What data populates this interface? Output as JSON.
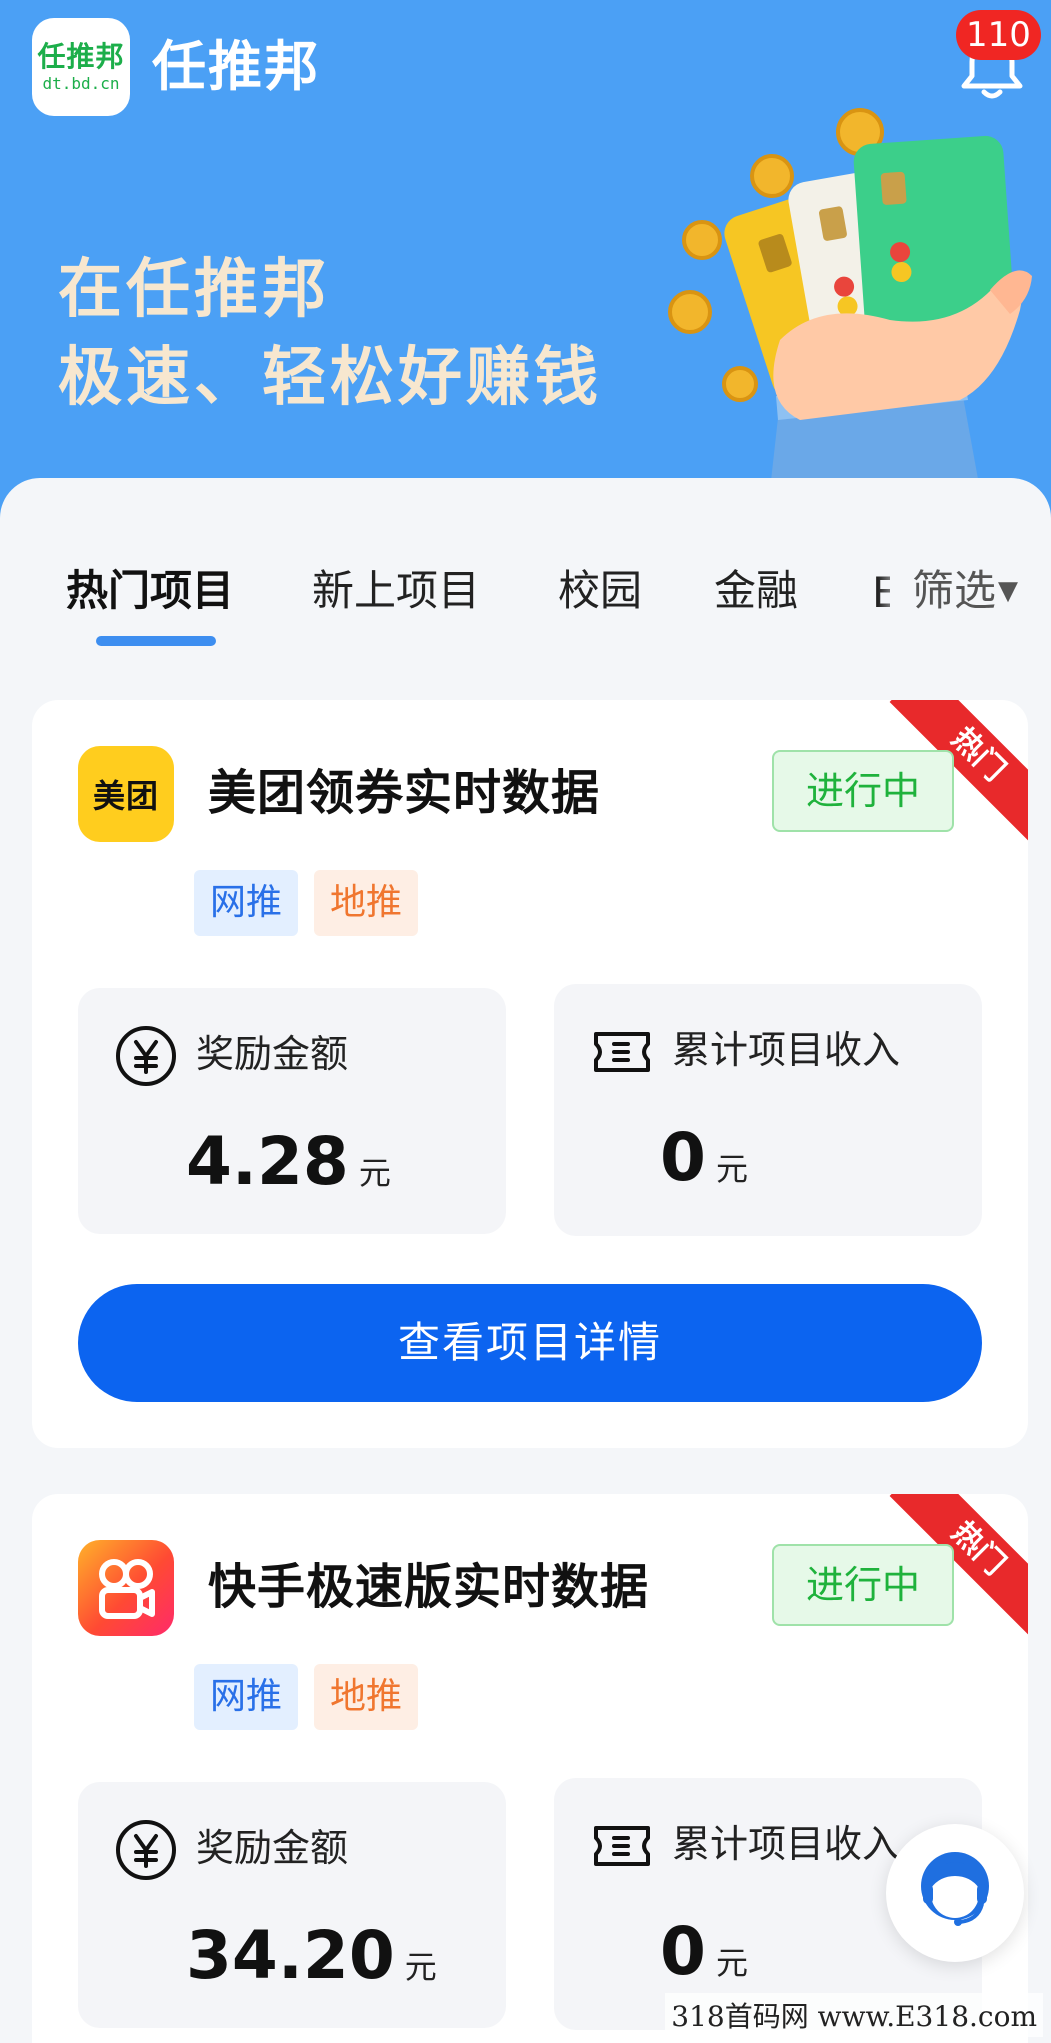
{
  "header": {
    "logo_text": "任推邦",
    "logo_domain": "dt.bd.cn",
    "app_title": "任推邦",
    "notification_count": "110",
    "slogan_line1": "在任推邦",
    "slogan_line2": "极速、轻松好赚钱",
    "banner_color": "#4ba0f5"
  },
  "tabs": {
    "items": [
      {
        "label": "热门项目",
        "active": true
      },
      {
        "label": "新上项目",
        "active": false
      },
      {
        "label": "校园",
        "active": false
      },
      {
        "label": "金融",
        "active": false
      }
    ],
    "overflow_partial": "E",
    "filter_label": "筛选",
    "filter_icon": "caret-down-icon"
  },
  "projects": [
    {
      "icon_text": "美团",
      "name": "美团领券实时数据",
      "status": "进行中",
      "hot_label": "热门",
      "tags": [
        "网推",
        "地推"
      ],
      "reward_label": "奖励金额",
      "reward_value": "4.28",
      "reward_unit": "元",
      "income_label": "累计项目收入",
      "income_value": "0",
      "income_unit": "元",
      "button_label": "查看项目详情"
    },
    {
      "icon_name": "kuaishou-icon",
      "name": "快手极速版实时数据",
      "status": "进行中",
      "hot_label": "热门",
      "tags": [
        "网推",
        "地推"
      ],
      "reward_label": "奖励金额",
      "reward_value": "34.20",
      "reward_unit": "元",
      "income_label": "累计项目收入",
      "income_value": "0",
      "income_unit": "元"
    }
  ],
  "colors": {
    "accent": "#0c64f0",
    "status_green": "#1fb23c",
    "hot_red": "#e8292b",
    "badge_red": "#f02623"
  },
  "watermark": "318首码网 www.E318.com"
}
